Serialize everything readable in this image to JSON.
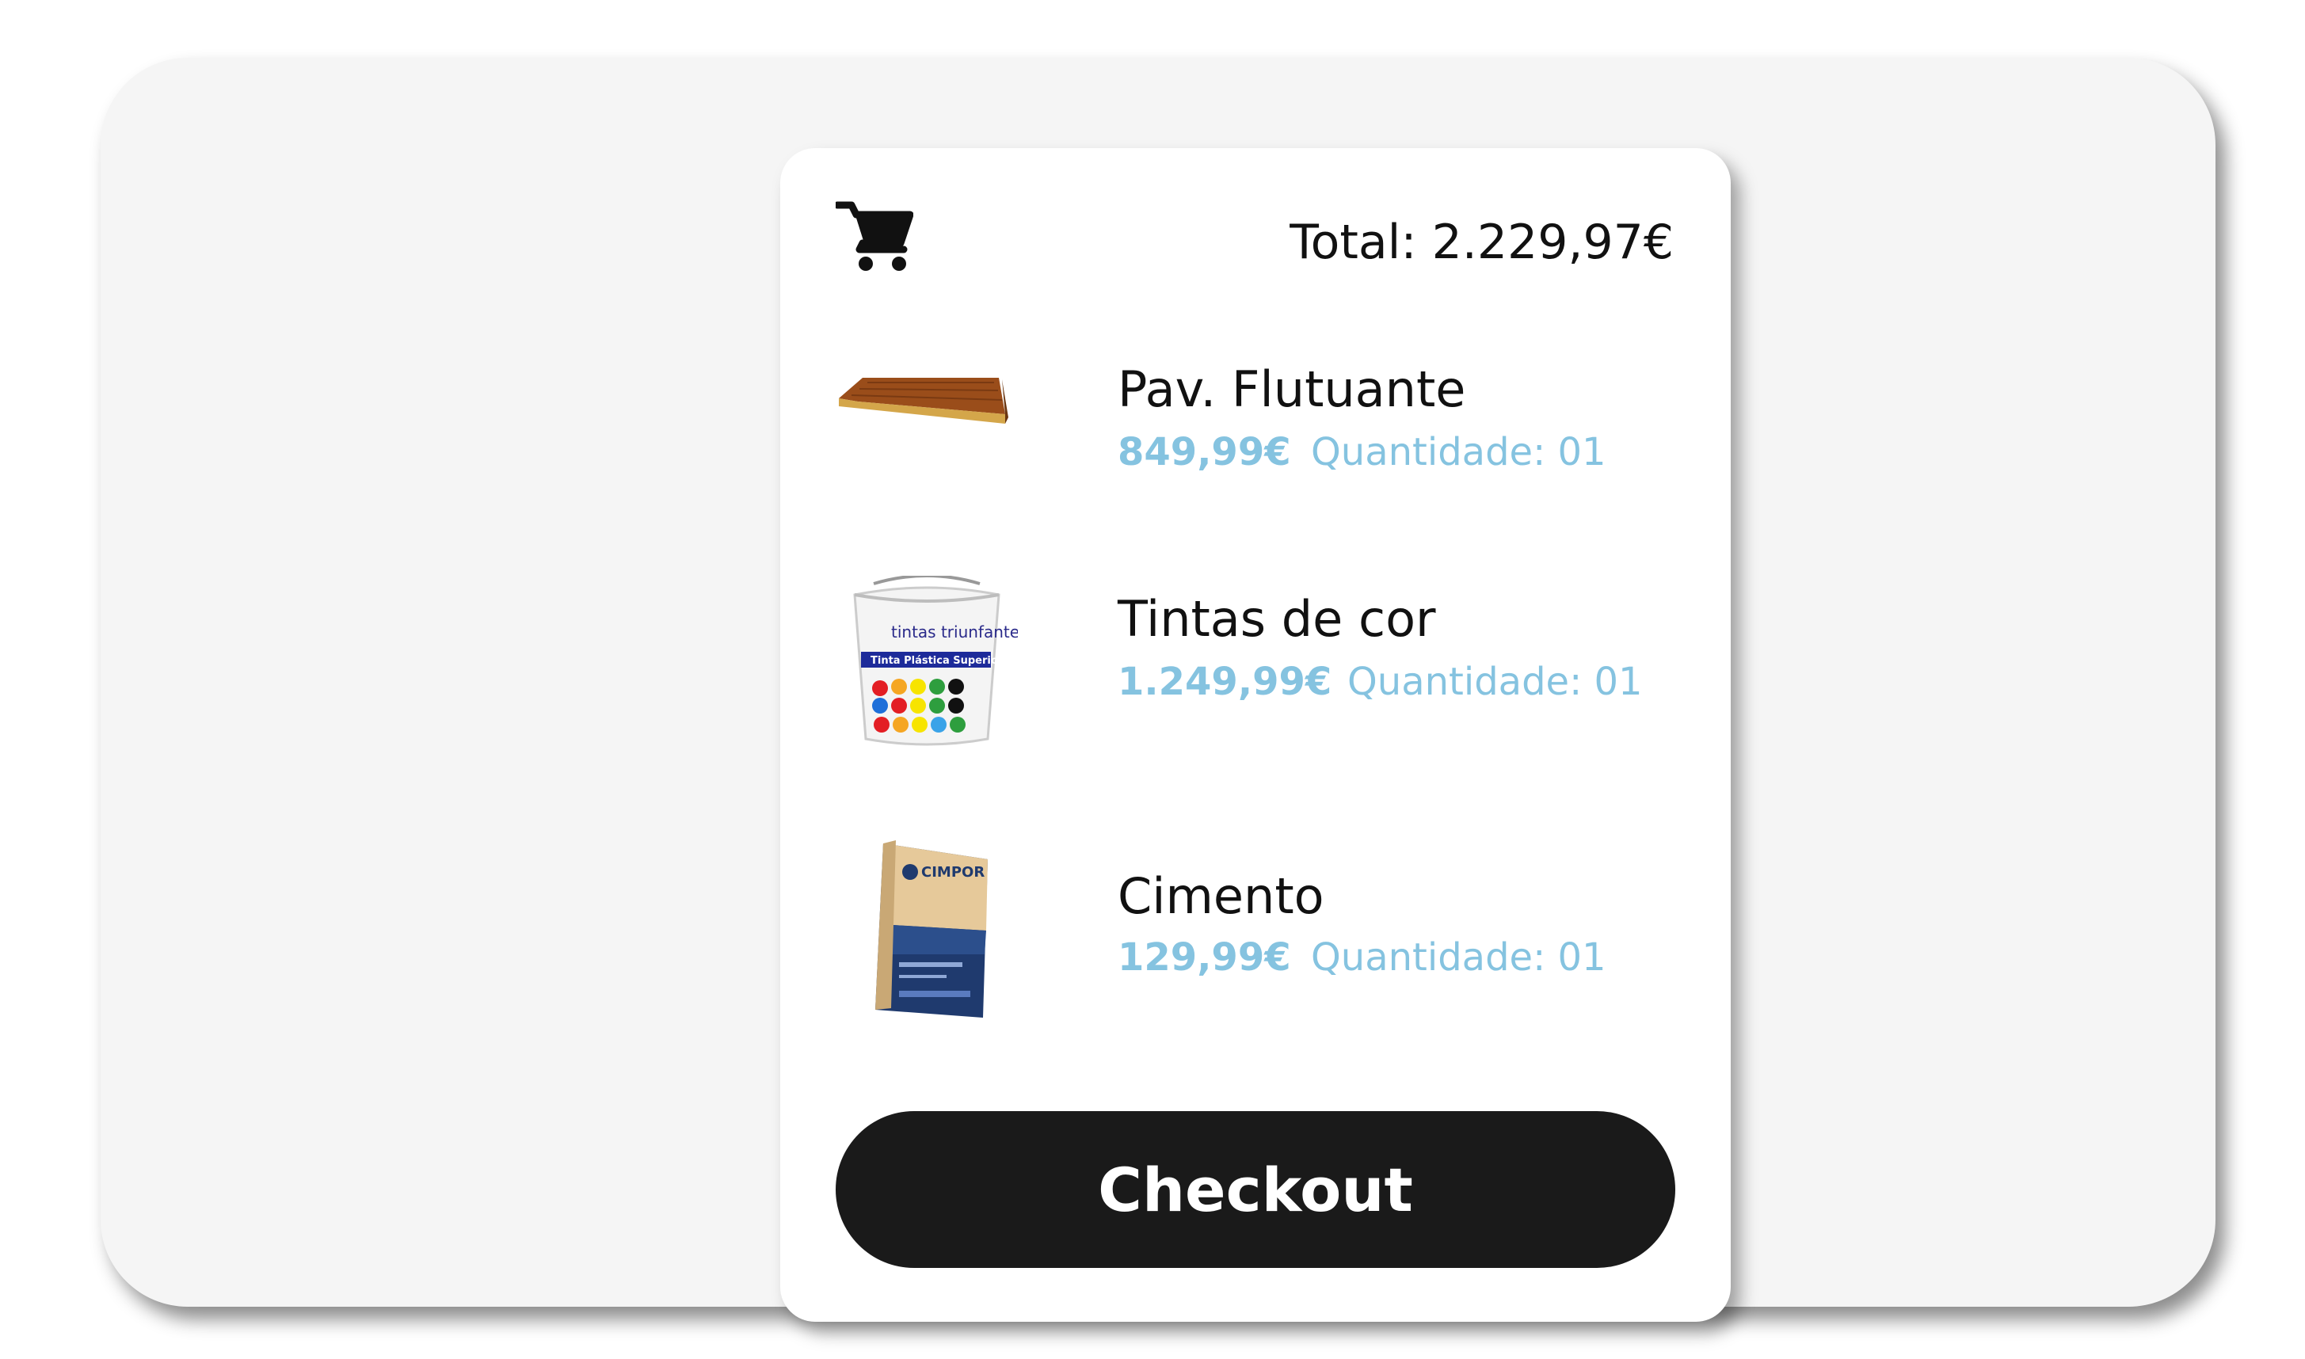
{
  "header": {
    "cart_icon": "shopping-cart-icon",
    "total_text": "Total: 2.229,97€"
  },
  "items": [
    {
      "name": "Pav. Flutuante",
      "price": "849,99€",
      "quantity": "Quantidade: 01",
      "image_icon": "floating-floor-plank-image"
    },
    {
      "name": "Tintas de cor",
      "price": "1.249,99€",
      "quantity": "Quantidade: 01",
      "image_icon": "paint-bucket-image",
      "image_brand": "tintas triunfante",
      "image_tagline": "Tinta Plástica Superior"
    },
    {
      "name": "Cimento",
      "price": "129,99€",
      "quantity": "Quantidade: 01",
      "image_icon": "cement-bag-image",
      "image_brand": "CIMPOR"
    }
  ],
  "checkout_label": "Checkout",
  "colors": {
    "accent": "#85c3e0",
    "button": "#1a1a1a",
    "text": "#111111",
    "background": "#f5f5f5",
    "card": "#ffffff"
  }
}
